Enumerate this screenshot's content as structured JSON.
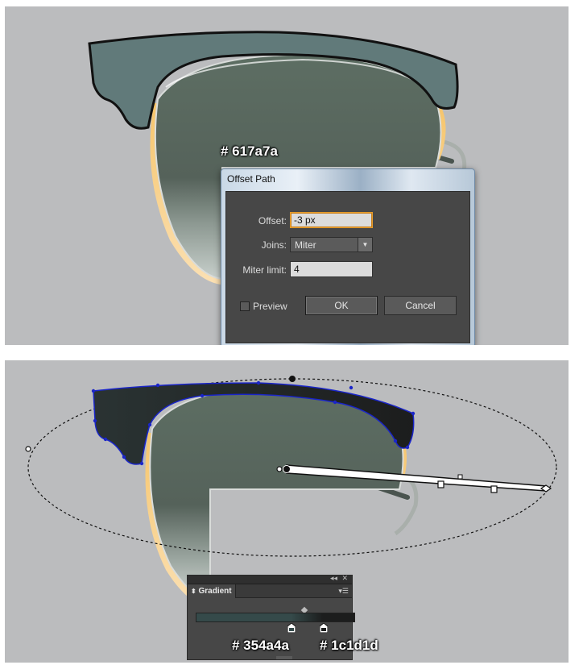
{
  "top_panel": {
    "color_label": "# 617a7a",
    "dialog": {
      "title": "Offset Path",
      "offset_label": "Offset:",
      "offset_value": "-3 px",
      "joins_label": "Joins:",
      "joins_value": "Miter",
      "miter_label": "Miter limit:",
      "miter_value": "4",
      "preview_label": "Preview",
      "ok_label": "OK",
      "cancel_label": "Cancel"
    }
  },
  "bottom_panel": {
    "gradient_panel": {
      "tab_label": "Gradient",
      "collapse_icon": "double-chevron-left-icon",
      "close_icon": "close-icon",
      "menu_icon": "panel-menu-icon",
      "stop_colors": [
        "#354a4a",
        "#1c1d1d"
      ]
    },
    "color_label_1": "# 354a4a",
    "color_label_2": "# 1c1d1d"
  },
  "colors": {
    "background": "#bbbcbe",
    "frame_top": "#617a7a",
    "lens": "#5c6b62",
    "gold_rim": "#f2b45a"
  }
}
